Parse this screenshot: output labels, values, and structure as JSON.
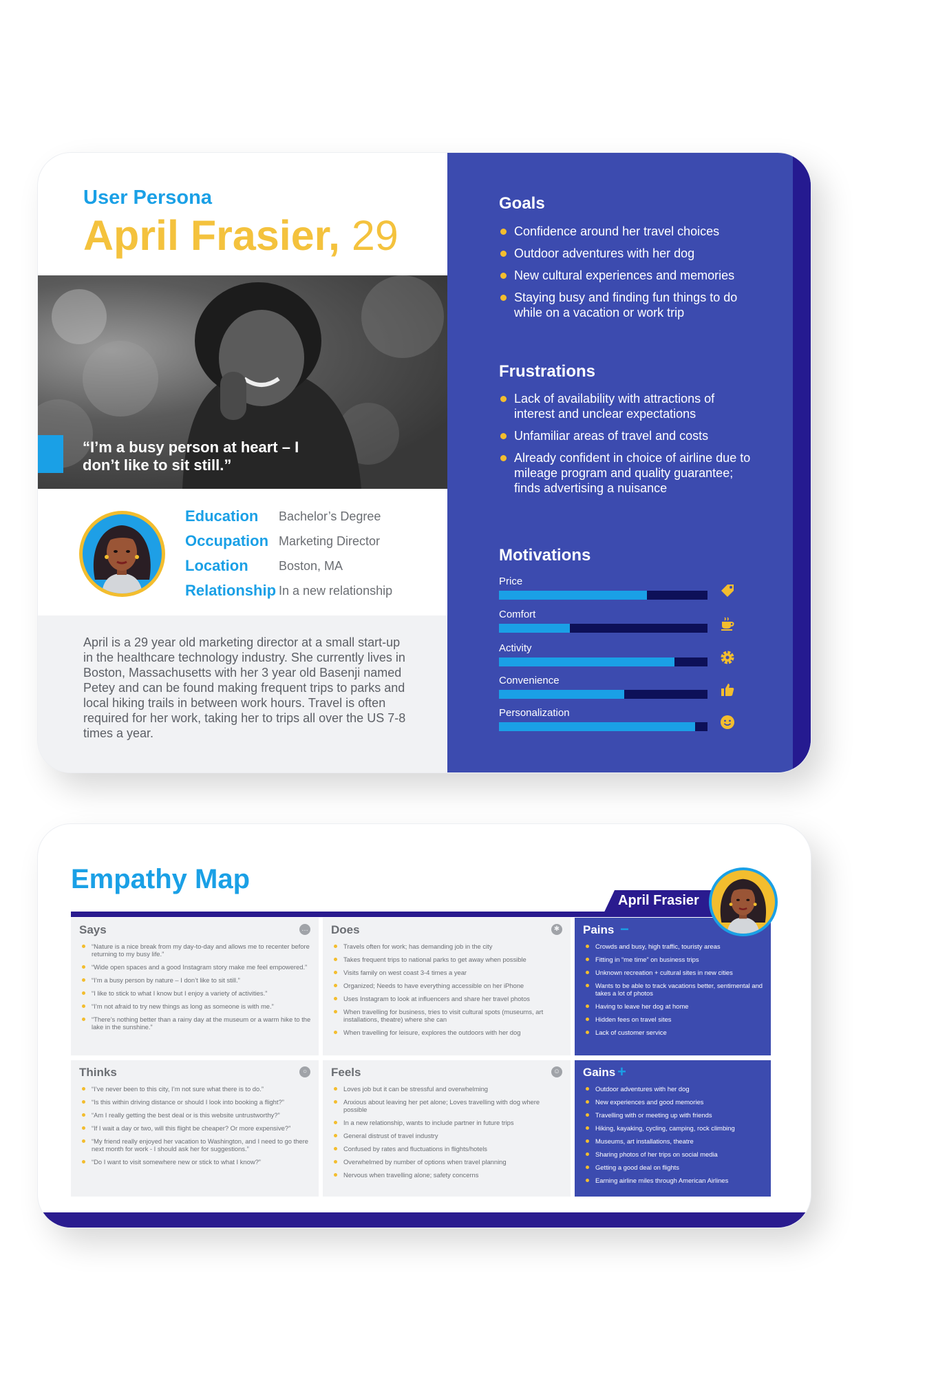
{
  "persona": {
    "eyebrow": "User Persona",
    "name": "April Frasier,",
    "age": " 29",
    "quote": "“I’m a busy person at heart – I don’t like to sit still.”",
    "facts": [
      {
        "label": "Education",
        "value": "Bachelor’s Degree"
      },
      {
        "label": "Occupation",
        "value": "Marketing Director"
      },
      {
        "label": "Location",
        "value": "Boston, MA"
      },
      {
        "label": "Relationship",
        "value": "In a new relationship"
      }
    ],
    "bio": "April is a 29 year old marketing director at a small start-up in the healthcare technology industry. She currently lives in Boston, Massachusetts with her 3 year old Basenji named Petey and can be found making frequent trips to parks and local hiking trails in between work hours. Travel is often required for her work, taking her to trips all over the US 7-8 times a year.",
    "goals": {
      "title": "Goals",
      "items": [
        "Confidence around her travel choices",
        "Outdoor adventures with her dog",
        "New cultural experiences and memories",
        "Staying busy and finding fun things to do while on a vacation or work trip"
      ]
    },
    "frustrations": {
      "title": "Frustrations",
      "items": [
        "Lack of availability with attractions of interest and unclear expectations",
        "Unfamiliar areas of travel and costs",
        "Already confident in choice of airline due to mileage program and quality guarantee; finds advertising a nuisance"
      ]
    },
    "motivations": {
      "title": "Motivations",
      "items": [
        {
          "label": "Price",
          "level": 0.71,
          "icon": "price-tag-icon"
        },
        {
          "label": "Comfort",
          "level": 0.34,
          "icon": "coffee-cup-icon"
        },
        {
          "label": "Activity",
          "level": 0.84,
          "icon": "gear-icon"
        },
        {
          "label": "Convenience",
          "level": 0.6,
          "icon": "thumbs-up-icon"
        },
        {
          "label": "Personalization",
          "level": 0.94,
          "icon": "smiley-icon"
        }
      ]
    }
  },
  "empathy": {
    "title": "Empathy Map",
    "tag": "April Frasier",
    "says": {
      "title": "Says",
      "items": [
        "“Nature is a nice break from my day-to-day and allows me to recenter before returning to my busy life.”",
        "“Wide open spaces and a good Instagram story make me feel empowered.”",
        "“I’m a busy person by nature – I don’t like to sit still.”",
        "“I like to stick to what I know but I enjoy a variety of activities.”",
        "“I’m not afraid to try new things as long as someone is with me.”",
        "“There’s nothing better than a rainy day at the museum or a warm hike to the lake in the sunshine.”"
      ]
    },
    "does": {
      "title": "Does",
      "items": [
        "Travels often for work; has demanding job in the city",
        "Takes frequent trips to national parks to get away when possible",
        "Visits family on west coast 3-4 times a year",
        "Organized; Needs to have everything accessible on her iPhone",
        "Uses Instagram to look at influencers and share her travel photos",
        "When travelling for business, tries to visit cultural spots (museums, art installations, theatre) where she can",
        "When travelling for leisure, explores the outdoors with her dog"
      ]
    },
    "pains": {
      "title": "Pains",
      "items": [
        "Crowds and busy, high traffic, touristy areas",
        "Fitting in “me time” on business trips",
        "Unknown recreation + cultural sites in new cities",
        "Wants to be able to track vacations better, sentimental and takes a lot of photos",
        "Having to leave her dog at home",
        "Hidden fees on travel sites",
        "Lack of customer service"
      ]
    },
    "thinks": {
      "title": "Thinks",
      "items": [
        "“I’ve never been to this city, I’m not sure what there is to do.”",
        "“Is this within driving distance or should I look into booking a flight?”",
        "“Am I really getting the best deal or is this website untrustworthy?”",
        "“If I wait a day or two, will this flight be cheaper? Or more expensive?”",
        "“My friend really enjoyed her vacation to Washington, and I need to go there next month for work - I should ask her for suggestions.”",
        "“Do I want to visit somewhere new or stick to what I know?”"
      ]
    },
    "feels": {
      "title": "Feels",
      "items": [
        "Loves job but it can be stressful and overwhelming",
        "Anxious about leaving her pet alone; Loves travelling with dog where possible",
        "In a new relationship, wants to include partner in future trips",
        "General distrust of travel industry",
        "Confused by rates and fluctuations in flights/hotels",
        "Overwhelmed by number of options when travel planning",
        "Nervous when travelling alone; safety concerns"
      ]
    },
    "gains": {
      "title": "Gains",
      "items": [
        "Outdoor adventures with her dog",
        "New experiences and good memories",
        "Travelling with or meeting up with friends",
        "Hiking, kayaking, cycling, camping, rock climbing",
        "Museums, art installations, theatre",
        "Sharing photos of her trips on social media",
        "Getting a good deal on flights",
        "Earning airline miles through American Airlines"
      ]
    }
  },
  "colors": {
    "accent_blue": "#1aa0e6",
    "accent_yellow": "#f3bd2e",
    "panel_indigo": "#3c4baf",
    "deep_indigo": "#2a1b8f",
    "bar_track": "#0d1058"
  }
}
